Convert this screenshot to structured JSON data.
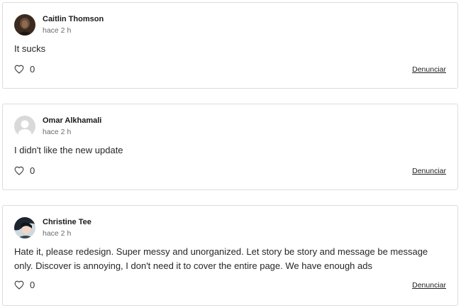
{
  "comments": [
    {
      "author": "Caitlin Thomson",
      "time": "hace 2 h",
      "text": "It sucks",
      "likes": "0",
      "report_label": "Denunciar",
      "avatar": "photo-dark"
    },
    {
      "author": "Omar Alkhamali",
      "time": "hace 2 h",
      "text": "I didn't like the new update",
      "likes": "0",
      "report_label": "Denunciar",
      "avatar": "default-user"
    },
    {
      "author": "Christine Tee",
      "time": "hace 2 h",
      "text": "Hate it, please redesign. Super messy and unorganized. Let story be story and message be message only. Discover is annoying, I don't need it to cover the entire page. We have enough ads",
      "likes": "0",
      "report_label": "Denunciar",
      "avatar": "photo-illustrated"
    }
  ],
  "icons": {
    "like": "heart-outline-icon"
  }
}
